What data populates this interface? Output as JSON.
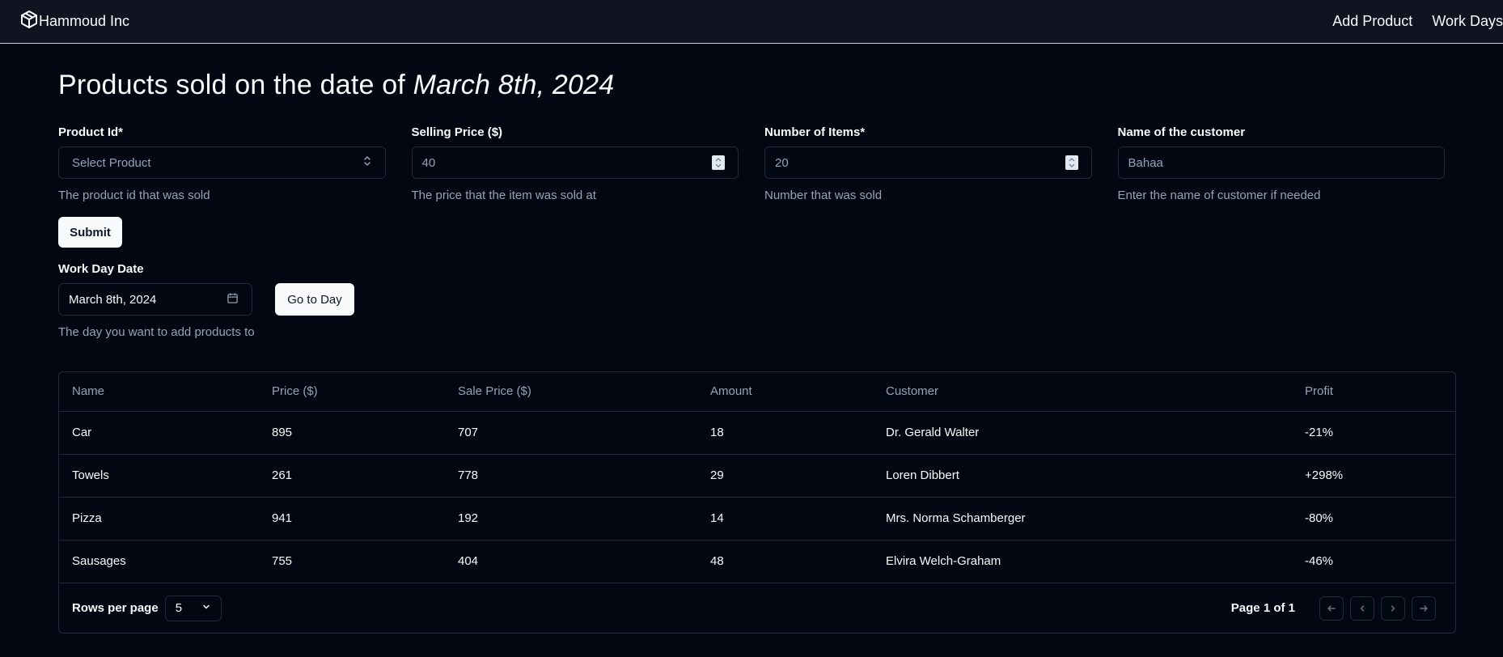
{
  "navbar": {
    "brand": "Hammoud Inc",
    "links": [
      "Add Product",
      "Work Days"
    ]
  },
  "page": {
    "title_prefix": "Products sold on the date of ",
    "title_date": "March 8th, 2024"
  },
  "form": {
    "product_id": {
      "label": "Product Id*",
      "value": "Select Product",
      "help": "The product id that was sold"
    },
    "selling_price": {
      "label": "Selling Price ($)",
      "value": "40",
      "help": "The price that the item was sold at"
    },
    "number_items": {
      "label": "Number of Items*",
      "value": "20",
      "help": "Number that was sold"
    },
    "customer": {
      "label": "Name of the customer",
      "value": "Bahaa",
      "help": "Enter the name of customer if needed"
    },
    "submit_label": "Submit"
  },
  "workday": {
    "label": "Work Day Date",
    "value": "March 8th, 2024",
    "help": "The day you want to add products to",
    "go_label": "Go to Day"
  },
  "table": {
    "headers": [
      "Name",
      "Price ($)",
      "Sale Price ($)",
      "Amount",
      "Customer",
      "Profit"
    ],
    "rows": [
      [
        "Car",
        "895",
        "707",
        "18",
        "Dr. Gerald Walter",
        "-21%"
      ],
      [
        "Towels",
        "261",
        "778",
        "29",
        "Loren Dibbert",
        "+298%"
      ],
      [
        "Pizza",
        "941",
        "192",
        "14",
        "Mrs. Norma Schamberger",
        "-80%"
      ],
      [
        "Sausages",
        "755",
        "404",
        "48",
        "Elvira Welch-Graham",
        "-46%"
      ]
    ],
    "rows_per_page_label": "Rows per page",
    "rows_per_page_value": "5",
    "page_info": "Page 1 of 1"
  }
}
